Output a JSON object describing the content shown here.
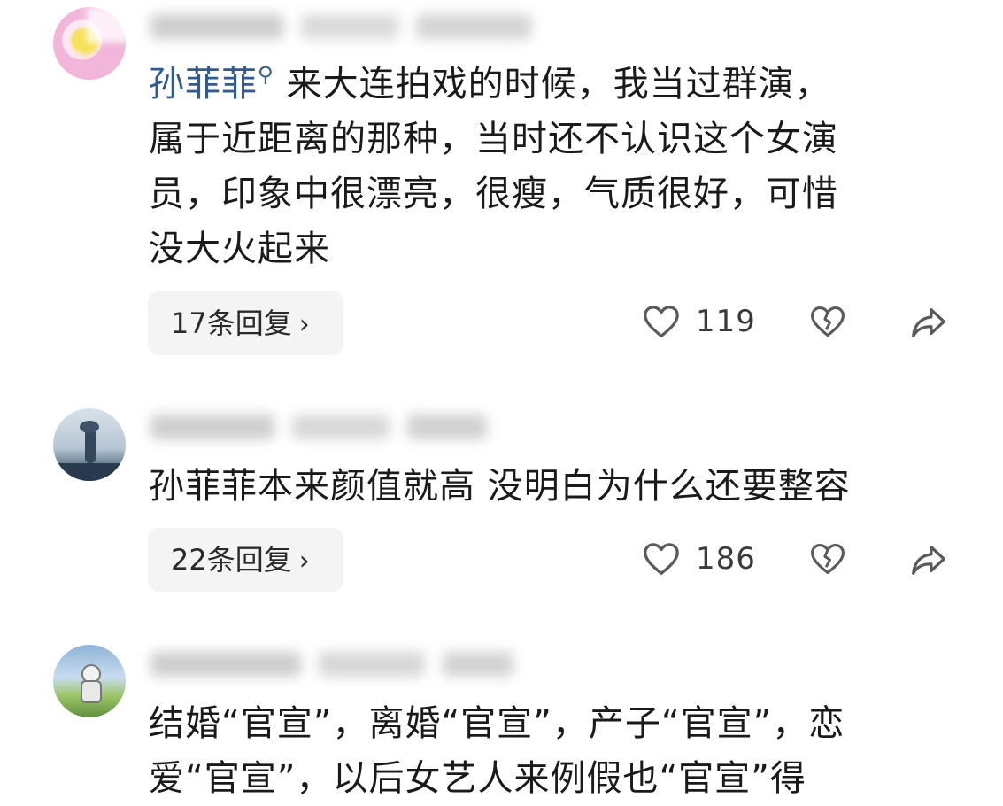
{
  "comments": [
    {
      "mention": "孙菲菲",
      "text_lines": [
        "来大连拍戏的时候，我当过群演，",
        "属于近距离的那种，当时还不认识这个女演",
        "员，印象中很漂亮，很瘦，气质很好，可惜",
        "没大火起来"
      ],
      "replies_label": "17条回复",
      "like_count": "119"
    },
    {
      "text_lines": [
        "孙菲菲本来颜值就高 没明白为什么还要整容"
      ],
      "replies_label": "22条回复",
      "like_count": "186"
    },
    {
      "text_lines": [
        "结婚“官宣”，离婚“官宣”，产子“官宣”，恋",
        "爱“官宣”，以后女艺人来例假也“官宣”得"
      ]
    }
  ],
  "icons": {
    "chevron": "chevron-right-icon",
    "like": "heart-outline-icon",
    "dislike": "broken-heart-icon",
    "share": "share-arrow-icon",
    "mention_search": "search-icon"
  },
  "colors": {
    "mention": "#2f5b92",
    "reply_bg": "#f4f4f4",
    "icon": "#5a5a5a"
  }
}
